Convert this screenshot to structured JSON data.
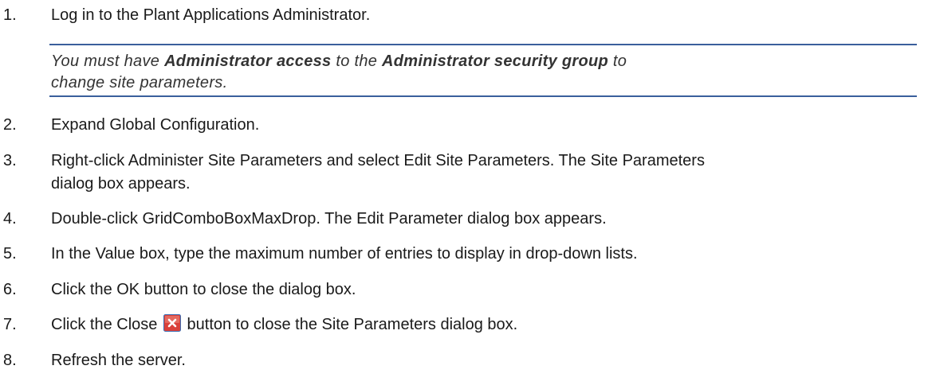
{
  "steps": [
    {
      "num": "1.",
      "text": "Log in to the Plant Applications Administrator."
    },
    {
      "num": "2.",
      "text": "Expand Global Configuration."
    },
    {
      "num": "3.",
      "line1": "Right-click Administer Site Parameters and select Edit Site Parameters. The Site Parameters",
      "line2": "dialog box appears."
    },
    {
      "num": "4.",
      "text": "Double-click GridComboBoxMaxDrop. The Edit Parameter dialog box appears."
    },
    {
      "num": "5.",
      "text": "In the Value box, type the maximum number of entries to display in drop-down lists."
    },
    {
      "num": "6.",
      "text": "Click the OK button to close the dialog box."
    },
    {
      "num": "7.",
      "before": "Click the Close",
      "after": "button to close the Site Parameters dialog box."
    },
    {
      "num": "8.",
      "text": "Refresh the server."
    }
  ],
  "note": {
    "part1": "You must have ",
    "bold1": "Administrator access",
    "part2": " to the ",
    "bold2": "Administrator security group",
    "part3": " to",
    "line2": "change site parameters."
  },
  "colors": {
    "note_rule": "#3a5f9c",
    "close_icon_bg": "#d9403a"
  },
  "icons": {
    "close": "close-icon"
  }
}
